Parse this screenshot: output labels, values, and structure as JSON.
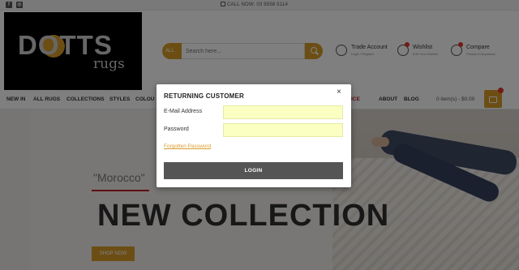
{
  "topbar": {
    "social": [
      {
        "name": "facebook-icon",
        "glyph": "f"
      },
      {
        "name": "instagram-icon",
        "glyph": "◎"
      }
    ],
    "call_text": "CALL NOW: 03 9558 5114"
  },
  "logo": {
    "text": "DOTTS",
    "sub": "rugs"
  },
  "search": {
    "category": "ALL",
    "placeholder": "Search here..."
  },
  "header_actions": [
    {
      "label": "Trade Account",
      "sub": "Login / Register"
    },
    {
      "label": "Wishlist",
      "sub": "Edit Your Wishlist"
    },
    {
      "label": "Compare",
      "sub": "Product Comparison"
    }
  ],
  "nav": {
    "items": [
      "NEW IN",
      "ALL RUGS",
      "COLLECTIONS",
      "STYLES",
      "COLOU",
      "ICE",
      "ABOUT",
      "BLOG"
    ],
    "cart": "0 item(s) - $0.00"
  },
  "hero": {
    "tag": "\"Morocco\"",
    "headline": "NEW COLLECTION",
    "button": "SHOP NOW"
  },
  "modal": {
    "title": "RETURNING CUSTOMER",
    "close": "×",
    "email_label": "E-Mail Address",
    "password_label": "Password",
    "forgot": "Forgotten Password",
    "login": "LOGIN"
  },
  "colors": {
    "accent": "#d89c2b",
    "badge": "#e2342d",
    "input_bg": "#fbffc2",
    "login_btn": "#555555"
  }
}
